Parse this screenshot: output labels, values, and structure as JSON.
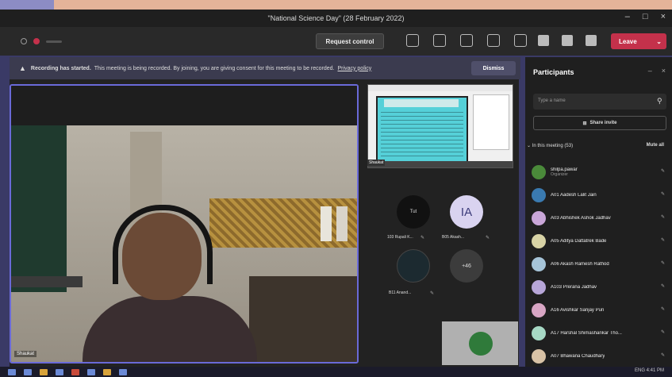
{
  "window": {
    "title": "\"National Science Day\" (28 February 2022)",
    "controls": [
      "–",
      "□",
      "×"
    ]
  },
  "toolbar": {
    "request_control": "Request control",
    "leave": "Leave",
    "leave_color": "#c4314b"
  },
  "banner": {
    "heading": "Recording has started.",
    "message": "This meeting is being recorded. By joining, you are giving consent for this meeting to be recorded.",
    "link": "Privacy policy",
    "dismiss": "Dismiss"
  },
  "main_video": {
    "caption": "Shaukat"
  },
  "screenshare": {
    "caption": "Shaukat"
  },
  "tiles": [
    {
      "initials": "Tut",
      "name": "103 Rupali K..."
    },
    {
      "initials": "IA",
      "name": "B05 Akash..."
    },
    {
      "initials": "",
      "name": "B11 Anand..."
    },
    {
      "initials": "+46",
      "name": ""
    }
  ],
  "participants_panel": {
    "title": "Participants",
    "search_placeholder": "Type a name",
    "share_invite": "Share invite",
    "section": "In this meeting (53)",
    "mute_all": "Mute all",
    "items": [
      {
        "name": "shilpa.pawar",
        "role": "Organizer"
      },
      {
        "name": "A01 Aadesh Lalit Jain",
        "role": ""
      },
      {
        "name": "A03 Abhishek Ashok Jadhav",
        "role": ""
      },
      {
        "name": "A05 Aditya Dattatrek Bade",
        "role": ""
      },
      {
        "name": "A06 Akash Ramesh Rathod",
        "role": ""
      },
      {
        "name": "A103 Prerana Jadhav",
        "role": ""
      },
      {
        "name": "A16 Avishkar Sanjay Puri",
        "role": ""
      },
      {
        "name": "A17 Harshal Shimashankar Tho...",
        "role": ""
      },
      {
        "name": "A07 Bhawana Chaudhary",
        "role": ""
      }
    ]
  },
  "taskbar": {
    "tray": "ENG 4:41 PM"
  }
}
